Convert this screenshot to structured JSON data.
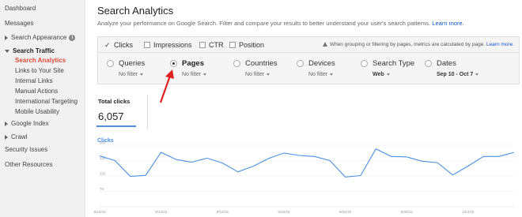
{
  "sidebar": {
    "items": [
      {
        "label": "Dashboard"
      },
      {
        "label": "Messages"
      },
      {
        "label": "Search Appearance"
      },
      {
        "label": "Search Traffic"
      },
      {
        "label": "Search Analytics"
      },
      {
        "label": "Links to Your Site"
      },
      {
        "label": "Internal Links"
      },
      {
        "label": "Manual Actions"
      },
      {
        "label": "International Targeting"
      },
      {
        "label": "Mobile Usability"
      },
      {
        "label": "Google Index"
      },
      {
        "label": "Crawl"
      },
      {
        "label": "Security Issues"
      },
      {
        "label": "Other Resources"
      }
    ],
    "info_glyph": "i"
  },
  "header": {
    "title": "Search Analytics",
    "description": "Analyze your performance on Google Search. Filter and compare your results to better understand your user's search patterns.",
    "learn_more": "Learn more."
  },
  "metrics": {
    "items": [
      {
        "label": "Clicks",
        "checked": true
      },
      {
        "label": "Impressions",
        "checked": false
      },
      {
        "label": "CTR",
        "checked": false
      },
      {
        "label": "Position",
        "checked": false
      }
    ],
    "check_glyph": "✓",
    "note": "When grouping or filtering by pages, metrics are calculated by page.",
    "note_link": "Learn more."
  },
  "filters": [
    {
      "label": "Queries",
      "value": "No filter",
      "selected": false
    },
    {
      "label": "Pages",
      "value": "No filter",
      "selected": true
    },
    {
      "label": "Countries",
      "value": "No filter",
      "selected": false
    },
    {
      "label": "Devices",
      "value": "No filter",
      "selected": false
    },
    {
      "label": "Search Type",
      "value": "Web",
      "selected": false
    },
    {
      "label": "Dates",
      "value": "Sep 10 - Oct 7",
      "selected": false
    }
  ],
  "summary": {
    "total_clicks_label": "Total clicks",
    "total_clicks_value": "6,057"
  },
  "chart_data": {
    "type": "line",
    "title": "",
    "series": [
      {
        "name": "Clicks",
        "values": [
          248,
          225,
          148,
          153,
          265,
          230,
          217,
          237,
          213,
          170,
          197,
          235,
          262,
          250,
          245,
          225,
          145,
          152,
          282,
          245,
          243,
          222,
          215,
          155,
          198,
          245,
          245,
          265
        ]
      }
    ],
    "legend": "Clicks",
    "x_ticks": [
      "9/10/15",
      "9/14/15",
      "9/18/15",
      "9/22/15",
      "9/26/15",
      "9/30/15",
      "10/4/15"
    ],
    "y_ticks": [
      75,
      150,
      225,
      300
    ],
    "ylim": [
      0,
      300
    ],
    "grid": true,
    "color": "#4a90e2"
  }
}
